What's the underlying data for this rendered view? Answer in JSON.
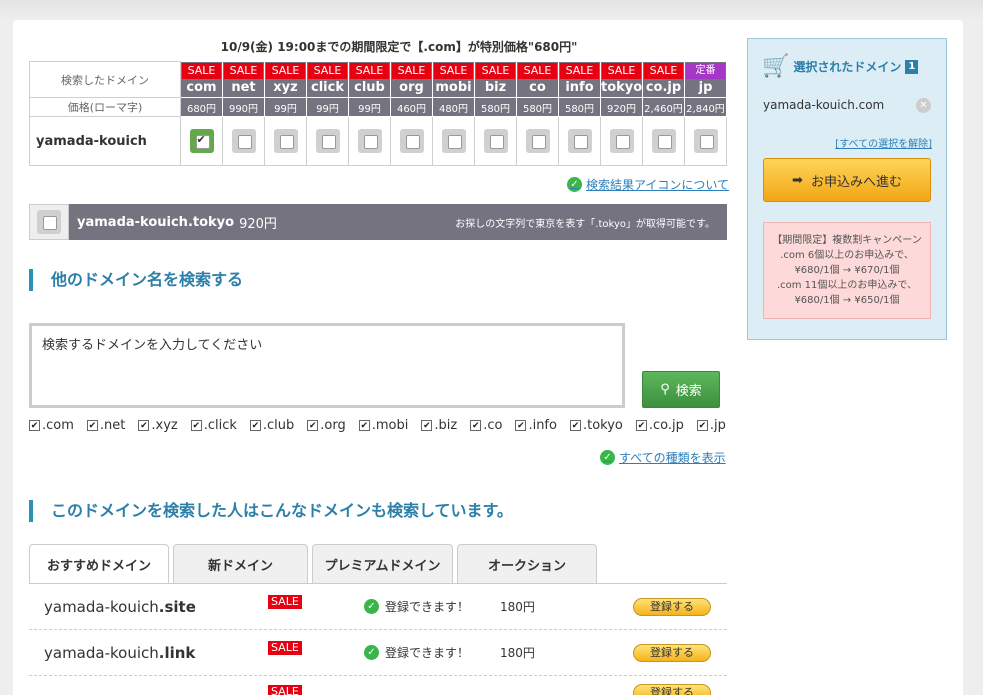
{
  "campaign_text": "10/9(金) 19:00までの期間限定で【.com】が特別価格\"680円\"",
  "table": {
    "searched_label": "検索したドメイン",
    "price_label": "価格(ローマ字)",
    "domain_name": "yamada-kouich",
    "tlds": [
      {
        "badge": "SALE",
        "name": "com",
        "price": "680円",
        "checked": true
      },
      {
        "badge": "SALE",
        "name": "net",
        "price": "990円"
      },
      {
        "badge": "SALE",
        "name": "xyz",
        "price": "99円"
      },
      {
        "badge": "SALE",
        "name": "click",
        "price": "99円"
      },
      {
        "badge": "SALE",
        "name": "club",
        "price": "99円"
      },
      {
        "badge": "SALE",
        "name": "org",
        "price": "460円"
      },
      {
        "badge": "SALE",
        "name": "mobi",
        "price": "480円"
      },
      {
        "badge": "SALE",
        "name": "biz",
        "price": "580円"
      },
      {
        "badge": "SALE",
        "name": "co",
        "price": "580円"
      },
      {
        "badge": "SALE",
        "name": "info",
        "price": "580円"
      },
      {
        "badge": "SALE",
        "name": "tokyo",
        "price": "920円"
      },
      {
        "badge": "SALE",
        "name": "co.jp",
        "price": "2,460円"
      },
      {
        "badge": "定番",
        "name": "jp",
        "price": "2,840円"
      }
    ]
  },
  "about_icons_link": "検索結果アイコンについて",
  "tokyo_bar": {
    "domain": "yamada-kouich.tokyo",
    "price": "920円",
    "note": "お探しの文字列で東京を表す「.tokyo」が取得可能です。"
  },
  "search_section": {
    "heading": "他のドメイン名を検索する",
    "placeholder": "検索するドメインを入力してください",
    "button": "検索",
    "tld_options": [
      ".com",
      ".net",
      ".xyz",
      ".click",
      ".club",
      ".org",
      ".mobi",
      ".biz",
      ".co",
      ".info",
      ".tokyo",
      ".co.jp",
      ".jp"
    ],
    "show_all_link": "すべての種類を表示"
  },
  "related": {
    "heading": "このドメインを検索した人はこんなドメインも検索しています。",
    "tabs": [
      "おすすめドメイン",
      "新ドメイン",
      "プレミアムドメイン",
      "オークション"
    ],
    "rows": [
      {
        "base": "yamada-kouich",
        "tld": ".site",
        "badge": "SALE",
        "status": "登録できます！",
        "price": "180円",
        "button": "登録する"
      },
      {
        "base": "yamada-kouich",
        "tld": ".link",
        "badge": "SALE",
        "status": "登録できます！",
        "price": "180円",
        "button": "登録する"
      },
      {
        "base": "",
        "tld": "",
        "badge": "SALE",
        "status": "",
        "price": "",
        "button": "登録する"
      }
    ]
  },
  "sidebar": {
    "title": "選択されたドメイン",
    "count": "1",
    "selected_domain": "yamada-kouich.com",
    "clear_all": "[すべての選択を解除]",
    "apply_button": "お申込みへ進む",
    "promo_lines": [
      "【期間限定】複数割キャンペーン",
      ".com 6個以上のお申込みで、",
      "¥680/1個 → ¥670/1個",
      ".com 11個以上のお申込みで、",
      "¥680/1個 → ¥650/1個"
    ]
  }
}
